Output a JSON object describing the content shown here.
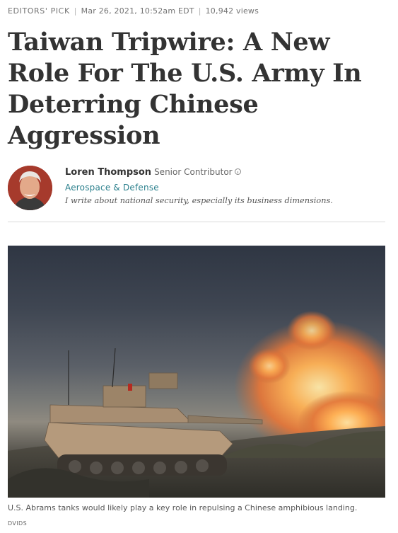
{
  "meta": {
    "label": "Editors' Pick",
    "date": "Mar 26, 2021, 10:52am EDT",
    "views": "10,942 views"
  },
  "article": {
    "title": "Taiwan Tripwire: A New Role For The U.S. Army In Deterring Chinese Aggression"
  },
  "author": {
    "name": "Loren Thompson",
    "role": "Senior Contributor",
    "section": "Aerospace & Defense",
    "bio": "I write about national security, especially its business dimensions."
  },
  "image": {
    "caption": "U.S. Abrams tanks would likely play a key role in repulsing a Chinese amphibious landing.",
    "credit": "DVIDS"
  },
  "icons": {
    "info": "info-icon"
  }
}
